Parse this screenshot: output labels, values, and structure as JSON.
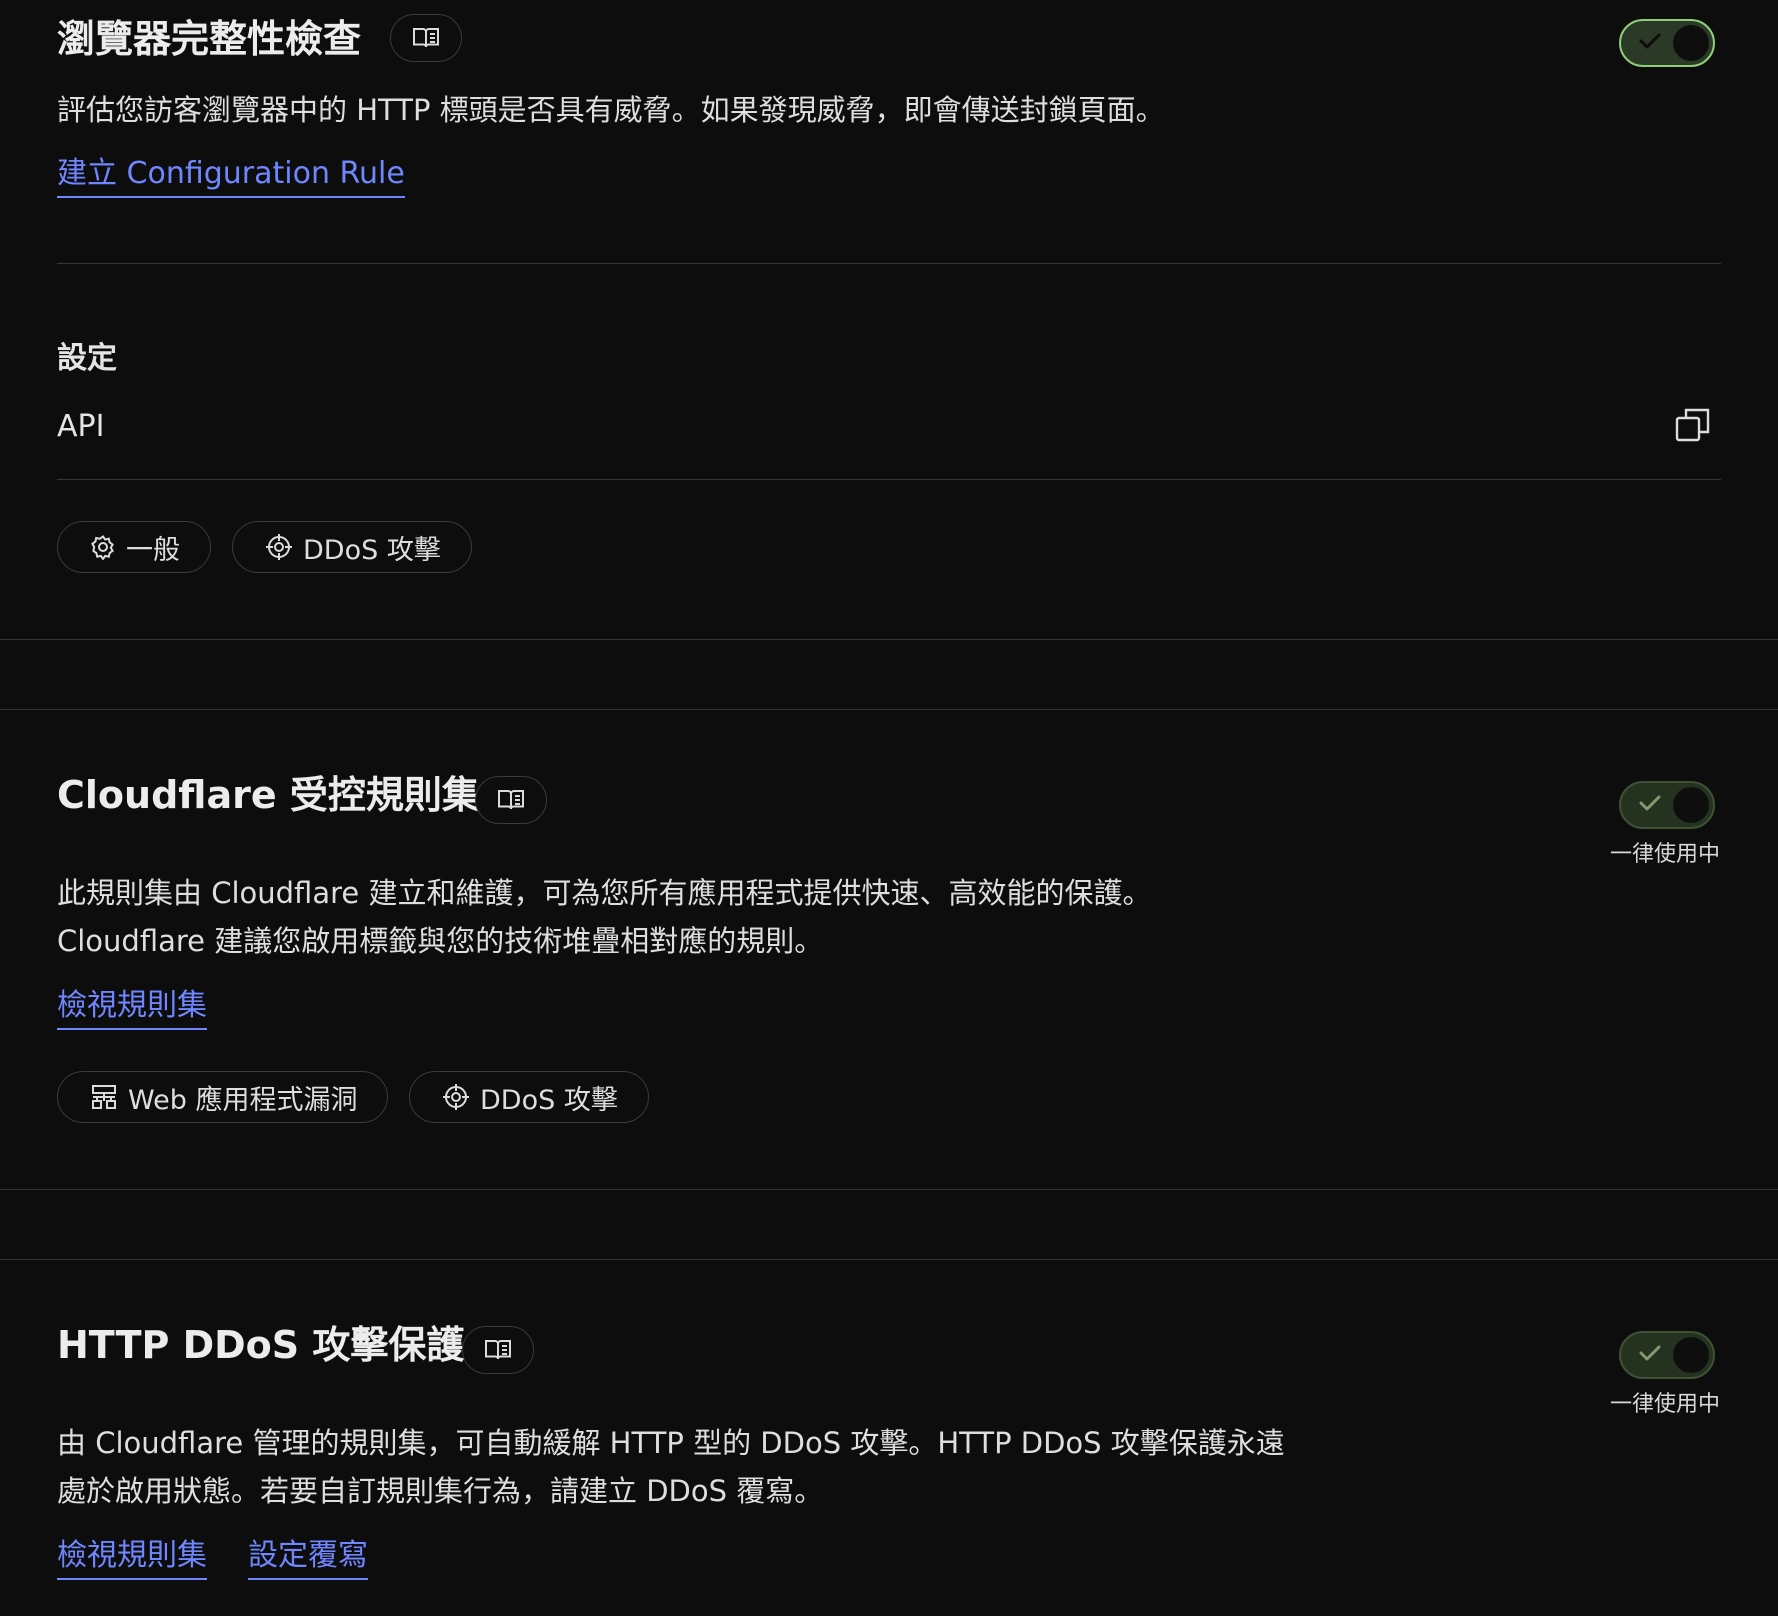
{
  "section_browser_check": {
    "title": "瀏覽器完整性檢查",
    "description": "評估您訪客瀏覽器中的 HTTP 標頭是否具有威脅。如果發現威脅，即會傳送封鎖頁面。",
    "link": "建立 Configuration Rule",
    "toggle_on": true,
    "settings_heading": "設定",
    "api_label": "API",
    "chips": [
      {
        "icon": "gear-icon",
        "label": "一般"
      },
      {
        "icon": "crosshair-icon",
        "label": "DDoS 攻擊"
      }
    ]
  },
  "section_managed_ruleset": {
    "title": "Cloudflare 受控規則集",
    "description_lines": [
      "此規則集由 Cloudflare 建立和維護，可為您所有應用程式提供快速、高效能的保護。",
      "Cloudflare 建議您啟用標籤與您的技術堆疊相對應的規則。"
    ],
    "status": "一律使用中",
    "toggle_on": true,
    "link": "檢視規則集",
    "chips": [
      {
        "icon": "network-icon",
        "label": "Web 應用程式漏洞"
      },
      {
        "icon": "crosshair-icon",
        "label": "DDoS 攻擊"
      }
    ]
  },
  "section_http_ddos": {
    "title": "HTTP DDoS 攻擊保護",
    "description_lines": [
      "由 Cloudflare 管理的規則集，可自動緩解 HTTP 型的 DDoS 攻擊。HTTP DDoS 攻擊保護永遠",
      "處於啟用狀態。若要自訂規則集行為，請建立 DDoS 覆寫。"
    ],
    "status": "一律使用中",
    "toggle_on": true,
    "links": [
      "檢視規則集",
      "設定覆寫"
    ]
  },
  "colors": {
    "background": "#0d0d0d",
    "link": "#6f86ff",
    "toggle_on_border": "#8fce79",
    "divider": "#363636"
  }
}
